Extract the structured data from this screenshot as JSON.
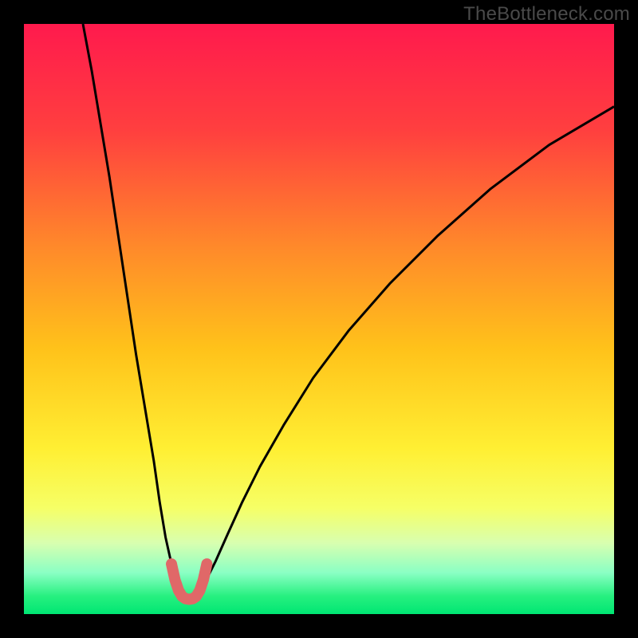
{
  "watermark": "TheBottleneck.com",
  "chart_data": {
    "type": "line",
    "title": "",
    "xlabel": "",
    "ylabel": "",
    "xlim": [
      0,
      100
    ],
    "ylim": [
      0,
      100
    ],
    "grid": false,
    "legend": false,
    "background_gradient_stops": [
      {
        "offset": 0.0,
        "color": "#ff1a4d"
      },
      {
        "offset": 0.18,
        "color": "#ff3f3f"
      },
      {
        "offset": 0.38,
        "color": "#ff8a2a"
      },
      {
        "offset": 0.55,
        "color": "#ffc21a"
      },
      {
        "offset": 0.72,
        "color": "#ffef33"
      },
      {
        "offset": 0.82,
        "color": "#f6ff66"
      },
      {
        "offset": 0.88,
        "color": "#d8ffb0"
      },
      {
        "offset": 0.93,
        "color": "#8affc4"
      },
      {
        "offset": 0.97,
        "color": "#26f07f"
      },
      {
        "offset": 1.0,
        "color": "#00e673"
      }
    ],
    "series": [
      {
        "name": "curve-left",
        "type": "line",
        "color": "#000000",
        "width": 3,
        "x": [
          10.0,
          11.5,
          13.0,
          14.5,
          16.0,
          17.5,
          19.0,
          20.5,
          22.0,
          23.0,
          24.0,
          25.0,
          25.8,
          26.4,
          26.8,
          27.0
        ],
        "y": [
          100.0,
          92.0,
          83.0,
          74.0,
          64.0,
          54.0,
          44.0,
          35.0,
          26.0,
          19.0,
          13.0,
          8.5,
          5.5,
          3.8,
          3.2,
          3.0
        ]
      },
      {
        "name": "curve-right",
        "type": "line",
        "color": "#000000",
        "width": 3,
        "x": [
          29.0,
          29.4,
          30.0,
          31.0,
          32.5,
          34.5,
          37.0,
          40.0,
          44.0,
          49.0,
          55.0,
          62.0,
          70.0,
          79.0,
          89.0,
          100.0
        ],
        "y": [
          3.0,
          3.4,
          4.2,
          6.0,
          9.0,
          13.5,
          19.0,
          25.0,
          32.0,
          40.0,
          48.0,
          56.0,
          64.0,
          72.0,
          79.5,
          86.0
        ]
      },
      {
        "name": "highlight-u",
        "type": "line",
        "color": "#e06868",
        "width": 14,
        "linecap": "round",
        "x": [
          25.0,
          25.6,
          26.2,
          26.8,
          27.4,
          28.0,
          28.6,
          29.2,
          29.8,
          30.4,
          31.0
        ],
        "y": [
          8.5,
          5.8,
          4.0,
          3.0,
          2.6,
          2.5,
          2.6,
          3.0,
          4.0,
          5.8,
          8.5
        ]
      }
    ]
  }
}
